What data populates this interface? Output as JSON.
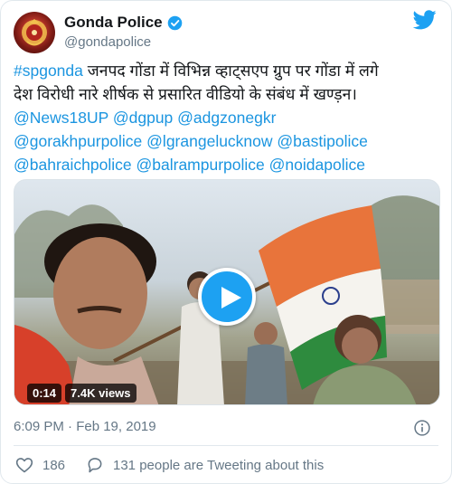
{
  "account": {
    "display_name": "Gonda Police",
    "handle": "@gondapolice"
  },
  "tweet": {
    "hashtag": "#spgonda",
    "text_line1": " जनपद गोंडा में विभिन्न व्हाट्सएप ग्रुप पर गोंडा में लगे",
    "text_line2": "देश विरोधी नारे  शीर्षक से प्रसारित वीडियो के संबंध में खण्ड़न।",
    "mentions": [
      "@News18UP",
      "@dgpup",
      "@adgzonegkr",
      "@gorakhpurpolice",
      "@lgrangelucknow",
      "@bastipolice",
      "@bahraichpolice",
      "@balrampurpolice",
      "@noidapolice"
    ]
  },
  "video": {
    "duration": "0:14",
    "views": "7.4K views"
  },
  "timestamp": "6:09 PM · Feb 19, 2019",
  "engagement": {
    "likes": "186",
    "conversation": "131 people are Tweeting about this"
  },
  "colors": {
    "link": "#1b95e0",
    "brand": "#1da1f2",
    "muted": "#657786",
    "flag_saffron": "#e8743b",
    "flag_green": "#2e8b3e"
  }
}
